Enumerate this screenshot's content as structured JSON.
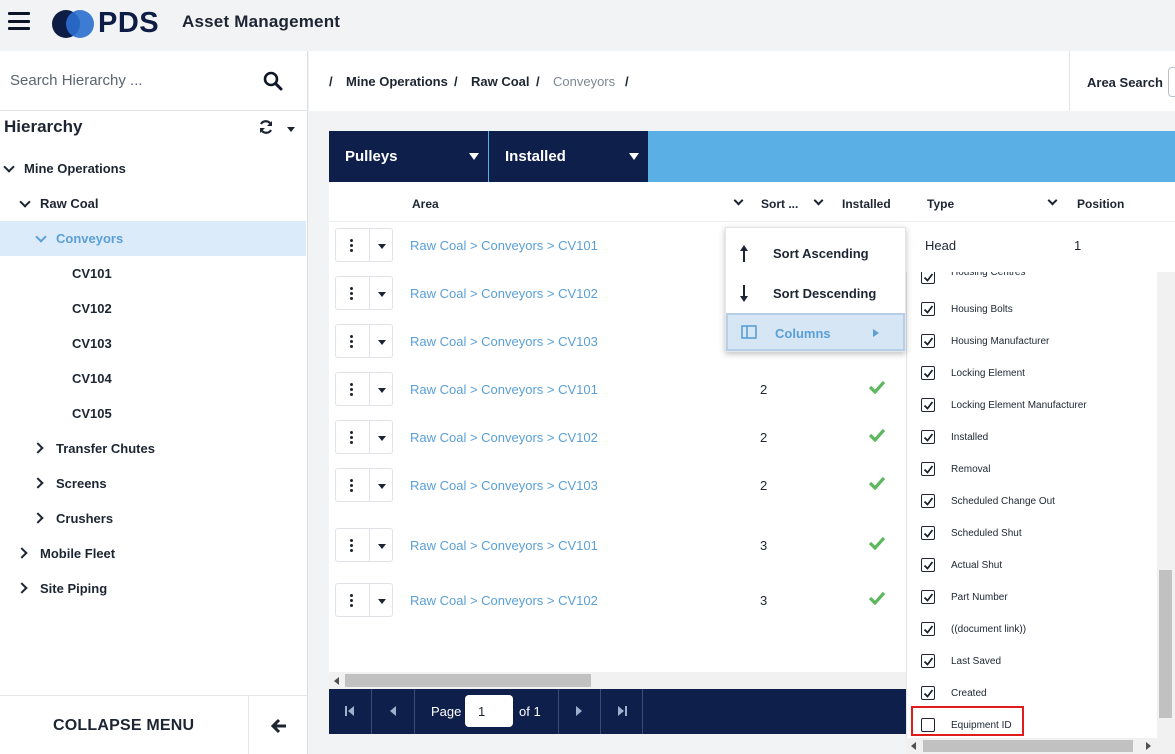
{
  "app": {
    "logo_text": "PDS",
    "title": "Asset Management"
  },
  "sidebar": {
    "search_placeholder": "Search Hierarchy ...",
    "hierarchy_title": "Hierarchy",
    "tree": [
      {
        "label": "Mine Operations",
        "level": 0,
        "state": "expanded"
      },
      {
        "label": "Raw Coal",
        "level": 1,
        "state": "expanded"
      },
      {
        "label": "Conveyors",
        "level": 2,
        "state": "expanded",
        "active": true
      },
      {
        "label": "CV101",
        "level": 3
      },
      {
        "label": "CV102",
        "level": 3
      },
      {
        "label": "CV103",
        "level": 3
      },
      {
        "label": "CV104",
        "level": 3
      },
      {
        "label": "CV105",
        "level": 3
      },
      {
        "label": "Transfer Chutes",
        "level": 2,
        "state": "collapsed"
      },
      {
        "label": "Screens",
        "level": 2,
        "state": "collapsed"
      },
      {
        "label": "Crushers",
        "level": 2,
        "state": "collapsed"
      },
      {
        "label": "Mobile Fleet",
        "level": 1,
        "state": "collapsed"
      },
      {
        "label": "Site Piping",
        "level": 1,
        "state": "collapsed"
      }
    ],
    "collapse_label": "COLLAPSE MENU"
  },
  "breadcrumb": {
    "items": [
      "Mine Operations",
      "Raw Coal",
      "Conveyors"
    ],
    "separator": "/"
  },
  "area_search": {
    "label": "Area Search"
  },
  "filters": {
    "asset_type": "Pulleys",
    "status": "Installed"
  },
  "grid": {
    "columns": [
      "Area",
      "Sort ...",
      "Installed",
      "Type",
      "Position"
    ],
    "rows": [
      {
        "area": "Raw Coal > Conveyors > CV101",
        "sort": "",
        "installed": false,
        "type": "Head",
        "position": "1"
      },
      {
        "area": "Raw Coal > Conveyors > CV102",
        "sort": "",
        "installed": false,
        "type": "",
        "position": ""
      },
      {
        "area": "Raw Coal > Conveyors > CV103",
        "sort": "",
        "installed": false,
        "type": "",
        "position": ""
      },
      {
        "area": "Raw Coal > Conveyors > CV101",
        "sort": "2",
        "installed": true,
        "type": "",
        "position": ""
      },
      {
        "area": "Raw Coal > Conveyors > CV102",
        "sort": "2",
        "installed": true,
        "type": "",
        "position": ""
      },
      {
        "area": "Raw Coal > Conveyors > CV103",
        "sort": "2",
        "installed": true,
        "type": "",
        "position": ""
      },
      {
        "area": "Raw Coal > Conveyors > CV101",
        "sort": "3",
        "installed": true,
        "type": "",
        "position": ""
      },
      {
        "area": "Raw Coal > Conveyors > CV102",
        "sort": "3",
        "installed": true,
        "type": "",
        "position": ""
      }
    ]
  },
  "pager": {
    "page_label": "Page",
    "page_value": "1",
    "of_label": "of 1"
  },
  "context_menu": {
    "sort_asc": "Sort Ascending",
    "sort_desc": "Sort Descending",
    "columns": "Columns"
  },
  "column_chooser": {
    "options": [
      {
        "label": "Housing Centres",
        "checked": true
      },
      {
        "label": "Housing Bolts",
        "checked": true
      },
      {
        "label": "Housing Manufacturer",
        "checked": true
      },
      {
        "label": "Locking Element",
        "checked": true
      },
      {
        "label": "Locking Element Manufacturer",
        "checked": true
      },
      {
        "label": "Installed",
        "checked": true
      },
      {
        "label": "Removal",
        "checked": true
      },
      {
        "label": "Scheduled Change Out",
        "checked": true
      },
      {
        "label": "Scheduled Shut",
        "checked": true
      },
      {
        "label": "Actual Shut",
        "checked": true
      },
      {
        "label": "Part Number",
        "checked": true
      },
      {
        "label": "((document link))",
        "checked": true
      },
      {
        "label": "Last Saved",
        "checked": true
      },
      {
        "label": "Created",
        "checked": true
      },
      {
        "label": "Equipment ID",
        "checked": false
      }
    ]
  },
  "colors": {
    "navy": "#0d1f4a",
    "accent_blue": "#5aafe4",
    "link_blue": "#5a9fd6",
    "check_green": "#5cb85c",
    "highlight_red": "#e01b1b"
  }
}
